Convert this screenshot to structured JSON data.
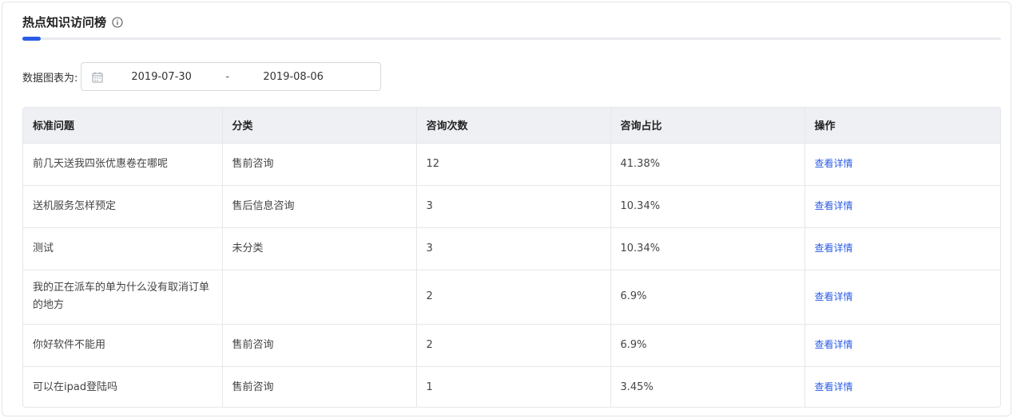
{
  "header": {
    "title": "热点知识访问榜",
    "info_icon": "info-circle-icon"
  },
  "filter": {
    "label": "数据图表为:",
    "calendar_icon": "calendar-icon",
    "start_date": "2019-07-30",
    "separator": "-",
    "end_date": "2019-08-06"
  },
  "table": {
    "columns": [
      "标准问题",
      "分类",
      "咨询次数",
      "咨询占比",
      "操作"
    ],
    "rows": [
      {
        "question": "前几天送我四张优惠卷在哪呢",
        "category": "售前咨询",
        "count": "12",
        "ratio": "41.38%",
        "action": "查看详情"
      },
      {
        "question": "送机服务怎样预定",
        "category": "售后信息咨询",
        "count": "3",
        "ratio": "10.34%",
        "action": "查看详情"
      },
      {
        "question": "测试",
        "category": "未分类",
        "count": "3",
        "ratio": "10.34%",
        "action": "查看详情"
      },
      {
        "question": "我的正在派车的单为什么没有取消订单的地方",
        "category": "",
        "count": "2",
        "ratio": "6.9%",
        "action": "查看详情"
      },
      {
        "question": "你好软件不能用",
        "category": "售前咨询",
        "count": "2",
        "ratio": "6.9%",
        "action": "查看详情"
      },
      {
        "question": "可以在ipad登陆吗",
        "category": "售前咨询",
        "count": "1",
        "ratio": "3.45%",
        "action": "查看详情"
      }
    ]
  },
  "colors": {
    "accent": "#2b5ce6",
    "header_bg": "#eef0f4",
    "border": "#e5e7eb"
  }
}
